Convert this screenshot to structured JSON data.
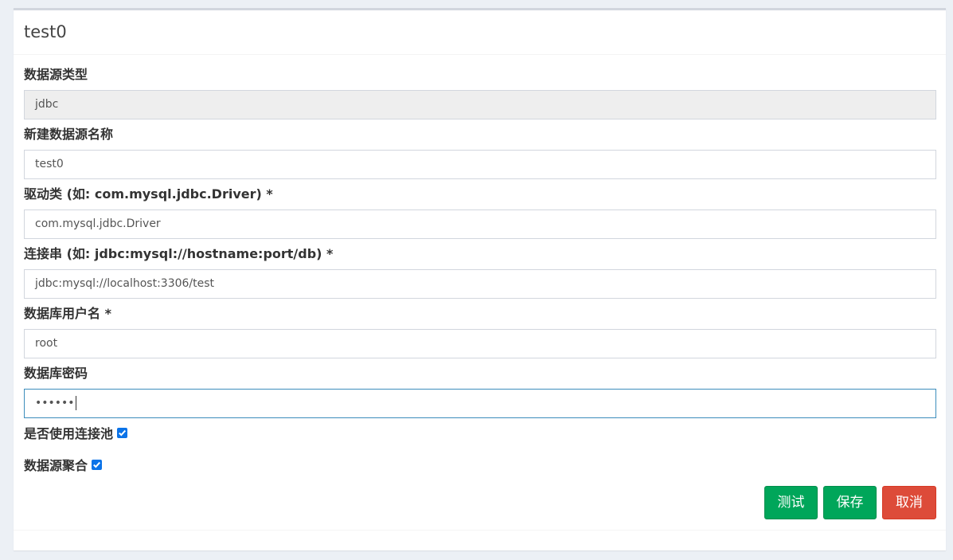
{
  "box": {
    "title": "test0"
  },
  "form": {
    "source_type": {
      "label": "数据源类型",
      "value": "jdbc"
    },
    "source_name": {
      "label": "新建数据源名称",
      "value": "test0"
    },
    "driver": {
      "label": "驱动类 (如: com.mysql.jdbc.Driver) *",
      "value": "com.mysql.jdbc.Driver"
    },
    "url": {
      "label": "连接串 (如: jdbc:mysql://hostname:port/db) *",
      "value": "jdbc:mysql://localhost:3306/test"
    },
    "username": {
      "label": "数据库用户名 *",
      "value": "root"
    },
    "password": {
      "label": "数据库密码",
      "value": "••••••"
    },
    "use_pool": {
      "label": "是否使用连接池",
      "checked": true
    },
    "aggregate": {
      "label": "数据源聚合",
      "checked": true
    }
  },
  "buttons": {
    "test": "测试",
    "save": "保存",
    "cancel": "取消"
  },
  "colors": {
    "success": "#00a65a",
    "danger": "#dd4b39",
    "focus_border": "#3c8dbc",
    "checkbox": "#0b73e8"
  }
}
